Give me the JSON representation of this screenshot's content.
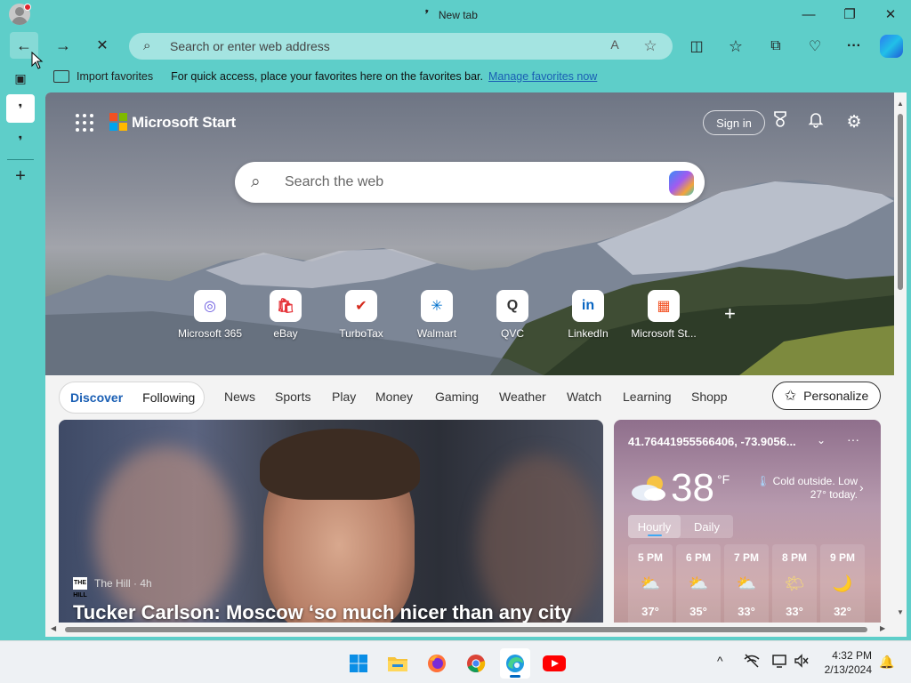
{
  "window": {
    "tab_title": "New tab",
    "tab_glyph": "❜",
    "minimize": "—",
    "restore": "❐",
    "close": "✕"
  },
  "nav": {
    "back": "←",
    "forward": "→",
    "stop": "✕",
    "address_placeholder": "Search or enter web address",
    "read_aloud": "A",
    "favorite_star": "☆",
    "split_screen": "◫",
    "favorites": "☆",
    "collections": "⧉",
    "performance": "♡",
    "more": "···"
  },
  "favorites_bar": {
    "import_label": "Import favorites",
    "hint": "For quick access, place your favorites here on the favorites bar.",
    "manage_link": "Manage favorites now"
  },
  "sidebar": {
    "tab_actions": "▣",
    "tab1": "❜",
    "tab2": "❜",
    "new_tab": "+"
  },
  "start": {
    "brand": "Microsoft Start",
    "logo_colors": [
      "#f25022",
      "#7fba00",
      "#00a4ef",
      "#ffb900"
    ],
    "sign_in": "Sign in",
    "rewards_icon": "🏆",
    "bell_icon": "🔔",
    "settings_icon": "⚙",
    "search_placeholder": "Search the web",
    "search_icon": "⌕",
    "quick_links": [
      {
        "label": "Microsoft 365",
        "glyph": "◎",
        "color": "#6a5ae0"
      },
      {
        "label": "eBay",
        "glyph": "🛍",
        "color": "#e53238"
      },
      {
        "label": "TurboTax",
        "glyph": "✔",
        "color": "#d52b1e"
      },
      {
        "label": "Walmart",
        "glyph": "✳",
        "color": "#0071ce"
      },
      {
        "label": "QVC",
        "glyph": "Q",
        "color": "#333333"
      },
      {
        "label": "LinkedIn",
        "glyph": "in",
        "color": "#0a66c2"
      },
      {
        "label": "Microsoft St...",
        "glyph": "▦",
        "color": "#f25022"
      }
    ],
    "add_link": "+"
  },
  "feed_tabs": {
    "discover": "Discover",
    "following": "Following",
    "items": [
      "News",
      "Sports",
      "Play",
      "Money",
      "Gaming",
      "Weather",
      "Watch",
      "Learning",
      "Shopp"
    ],
    "personalize": "Personalize",
    "personalize_icon": "✩"
  },
  "news": {
    "source_logo": "THE HILL",
    "source": "The Hill · 4h",
    "headline": "Tucker Carlson: Moscow ‘so much nicer than any city"
  },
  "weather": {
    "location": "41.76441955566406, -73.9056...",
    "location_dropdown": "⌄",
    "more": "···",
    "temperature": "38",
    "unit": "°F",
    "note": "Cold outside. Low 27° today.",
    "note_chevron": "›",
    "tabs": [
      "Hourly",
      "Daily"
    ],
    "hours": [
      {
        "time": "5 PM",
        "icon": "⛅",
        "temp": "37°"
      },
      {
        "time": "6 PM",
        "icon": "⛅",
        "temp": "35°"
      },
      {
        "time": "7 PM",
        "icon": "⛅",
        "temp": "33°"
      },
      {
        "time": "8 PM",
        "icon": "🌤",
        "temp": "33°"
      },
      {
        "time": "9 PM",
        "icon": "🌙",
        "temp": "32°"
      }
    ]
  },
  "scroll": {
    "up": "▲",
    "down": "▼",
    "left": "◀",
    "right": "▶"
  },
  "taskbar": {
    "time": "4:32 PM",
    "date": "2/13/2024",
    "tray_chevron": "^",
    "notification_icon": "🔔"
  }
}
